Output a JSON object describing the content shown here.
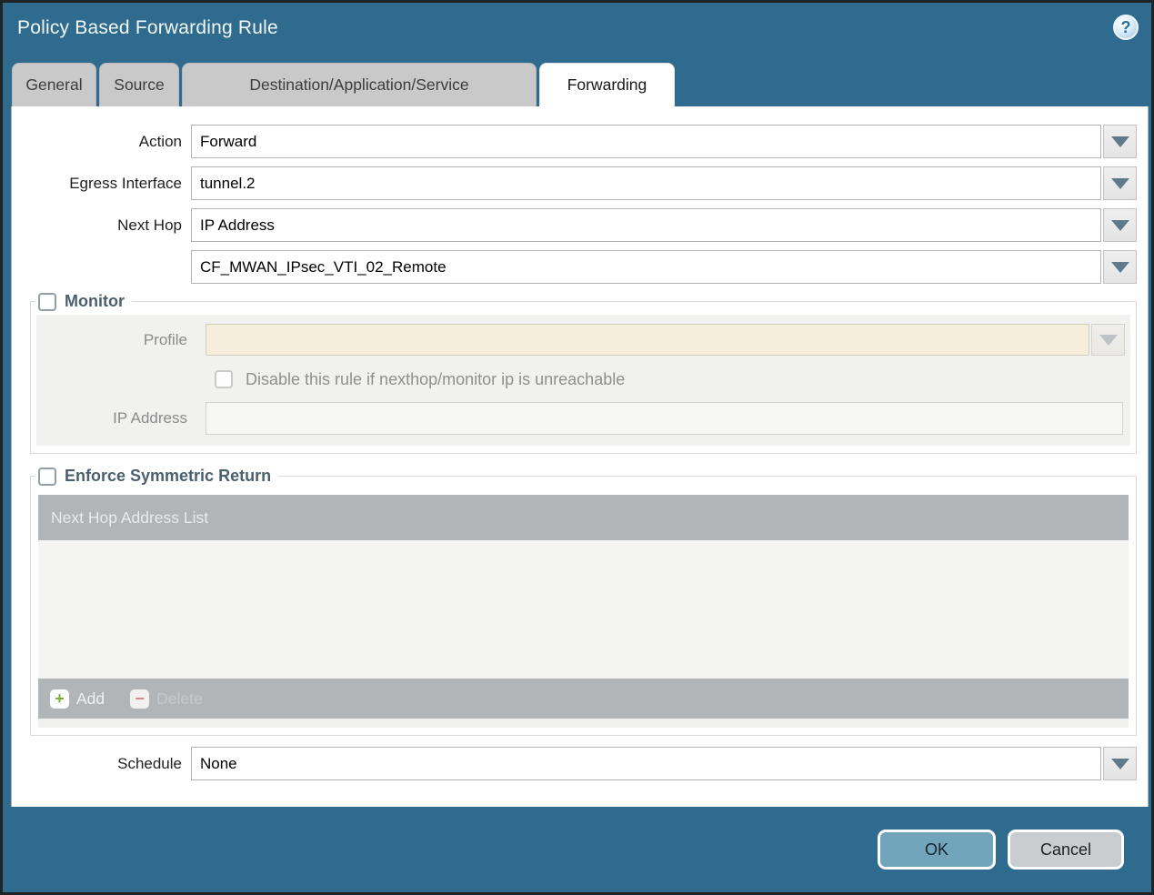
{
  "dialog": {
    "title": "Policy Based Forwarding Rule",
    "help_glyph": "?"
  },
  "tabs": [
    {
      "label": "General",
      "active": false
    },
    {
      "label": "Source",
      "active": false
    },
    {
      "label": "Destination/Application/Service",
      "active": false
    },
    {
      "label": "Forwarding",
      "active": true
    }
  ],
  "form": {
    "action": {
      "label": "Action",
      "value": "Forward"
    },
    "egress_interface": {
      "label": "Egress Interface",
      "value": "tunnel.2"
    },
    "next_hop": {
      "label": "Next Hop",
      "value": "IP Address"
    },
    "next_hop_address": {
      "value": "CF_MWAN_IPsec_VTI_02_Remote"
    },
    "schedule": {
      "label": "Schedule",
      "value": "None"
    }
  },
  "monitor": {
    "legend": "Monitor",
    "checked": false,
    "profile": {
      "label": "Profile",
      "value": ""
    },
    "disable_rule_checkbox": {
      "label": "Disable this rule if nexthop/monitor ip is unreachable",
      "checked": false
    },
    "ip_address": {
      "label": "IP Address",
      "value": ""
    }
  },
  "enforce_symmetric_return": {
    "legend": "Enforce Symmetric Return",
    "checked": false,
    "table": {
      "header": "Next Hop Address List",
      "rows": []
    },
    "add_label": "Add",
    "delete_label": "Delete",
    "add_glyph": "+",
    "delete_glyph": "−"
  },
  "footer": {
    "ok_label": "OK",
    "cancel_label": "Cancel"
  },
  "colors": {
    "chrome_teal": "#2e6b8e",
    "ok_button": "#72a5bc",
    "disabled_field_cream": "#f5eedd",
    "table_gray": "#b1b5b8",
    "add_plus_green": "#7fae3a",
    "delete_minus_red": "#cf8a8c"
  }
}
